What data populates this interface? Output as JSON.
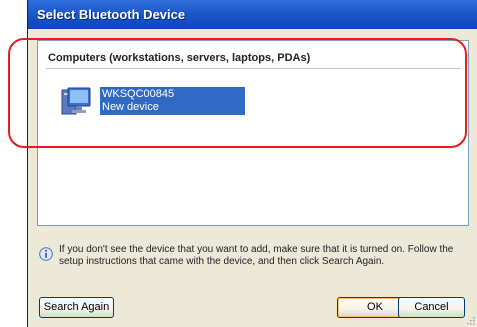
{
  "window": {
    "title": "Select Bluetooth Device"
  },
  "device_list": {
    "group_header": "Computers (workstations, servers, laptops, PDAs)",
    "devices": [
      {
        "name": "WKSQC00845",
        "status": "New device",
        "icon": "computer-icon",
        "selected": true
      }
    ]
  },
  "info": {
    "icon": "info-icon",
    "text": "If you don't see the device that you want to add, make sure that it is turned on. Follow the setup instructions that came with the device, and then click Search Again."
  },
  "buttons": {
    "search_again": "Search Again",
    "ok": "OK",
    "cancel": "Cancel"
  },
  "colors": {
    "selection": "#316ac5",
    "titlebar": "#1c58c9",
    "annotation": "#e02020"
  }
}
